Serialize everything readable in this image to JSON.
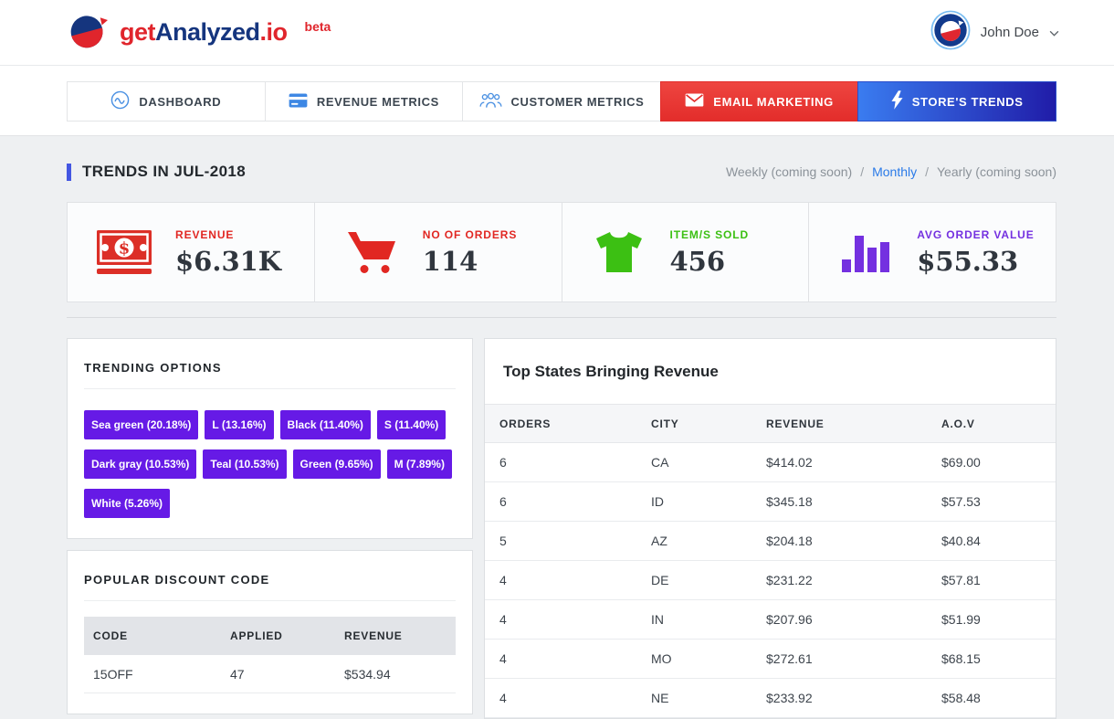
{
  "brand": {
    "logo_prefix": "get",
    "logo_name": "Analyzed",
    "logo_suffix": ".io",
    "badge": "beta"
  },
  "header": {
    "user_name": "John Doe"
  },
  "nav": {
    "tabs": [
      {
        "label": "DASHBOARD",
        "icon": "pulse-circle-icon",
        "active": false
      },
      {
        "label": "REVENUE METRICS",
        "icon": "credit-card-icon",
        "active": false
      },
      {
        "label": "CUSTOMER METRICS",
        "icon": "users-icon",
        "active": false
      },
      {
        "label": "EMAIL MARKETING",
        "icon": "envelope-icon",
        "active": true
      },
      {
        "label": "STORE'S TRENDS",
        "icon": "lightning-icon",
        "active": false
      }
    ]
  },
  "page": {
    "title": "TRENDS IN JUL-2018",
    "separator": "/",
    "period_options": [
      {
        "label": "Weekly (coming soon)",
        "state": "disabled"
      },
      {
        "label": "Monthly",
        "state": "active"
      },
      {
        "label": "Yearly (coming soon)",
        "state": "disabled"
      }
    ]
  },
  "metrics": [
    {
      "label": "REVENUE",
      "value": "$6.31K",
      "icon": "money-bill-icon",
      "color": "#e12722"
    },
    {
      "label": "NO OF ORDERS",
      "value": "114",
      "icon": "shopping-cart-icon",
      "color": "#e12722"
    },
    {
      "label": "ITEM/S SOLD",
      "value": "456",
      "icon": "tshirt-icon",
      "color": "#3cc013"
    },
    {
      "label": "AVG ORDER VALUE",
      "value": "$55.33",
      "icon": "bar-chart-icon",
      "color": "#7430e0"
    }
  ],
  "trending_options": {
    "title": "TRENDING OPTIONS",
    "tag_color": "#661ae6",
    "tags": [
      "Sea green (20.18%)",
      "L (13.16%)",
      "Black (11.40%)",
      "S (11.40%)",
      "Dark gray (10.53%)",
      "Teal (10.53%)",
      "Green (9.65%)",
      "M (7.89%)",
      "White (5.26%)"
    ]
  },
  "discount_codes": {
    "title": "POPULAR DISCOUNT CODE",
    "columns": [
      "CODE",
      "APPLIED",
      "REVENUE"
    ],
    "rows": [
      [
        "15OFF",
        "47",
        "$534.94"
      ]
    ]
  },
  "top_states": {
    "title": "Top States Bringing Revenue",
    "columns": [
      "ORDERS",
      "CITY",
      "REVENUE",
      "A.O.V"
    ],
    "rows": [
      [
        "6",
        "CA",
        "$414.02",
        "$69.00"
      ],
      [
        "6",
        "ID",
        "$345.18",
        "$57.53"
      ],
      [
        "5",
        "AZ",
        "$204.18",
        "$40.84"
      ],
      [
        "4",
        "DE",
        "$231.22",
        "$57.81"
      ],
      [
        "4",
        "IN",
        "$207.96",
        "$51.99"
      ],
      [
        "4",
        "MO",
        "$272.61",
        "$68.15"
      ],
      [
        "4",
        "NE",
        "$233.92",
        "$58.48"
      ]
    ]
  },
  "colors": {
    "brand_red": "#e0252c",
    "brand_navy": "#15357e",
    "accent_bar_blue": "#4356e2",
    "active_tab_red": "#e32d2b",
    "trends_gradient_start": "#3a7cf0",
    "trends_gradient_end": "#201ca8",
    "link_blue": "#2a7ae8",
    "metric_red": "#e12722",
    "metric_green": "#3cc013",
    "metric_purple": "#7430e0",
    "tag_purple": "#661ae6",
    "nav_icon_blue": "#4a90e2"
  }
}
